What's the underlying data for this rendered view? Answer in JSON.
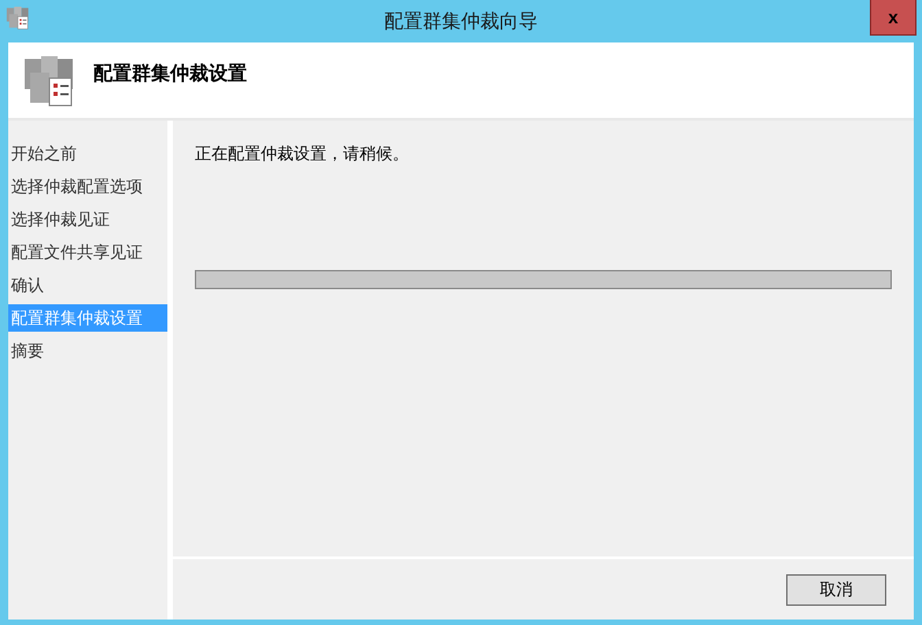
{
  "window": {
    "title": "配置群集仲裁向导",
    "close": "x"
  },
  "header": {
    "title": "配置群集仲裁设置"
  },
  "sidebar": {
    "items": [
      {
        "label": "开始之前",
        "selected": false
      },
      {
        "label": "选择仲裁配置选项",
        "selected": false
      },
      {
        "label": "选择仲裁见证",
        "selected": false
      },
      {
        "label": "配置文件共享见证",
        "selected": false
      },
      {
        "label": "确认",
        "selected": false
      },
      {
        "label": "配置群集仲裁设置",
        "selected": true
      },
      {
        "label": "摘要",
        "selected": false
      }
    ]
  },
  "content": {
    "message": "正在配置仲裁设置，请稍候。",
    "progress": {
      "level": 0
    }
  },
  "buttons": [
    "取消"
  ]
}
